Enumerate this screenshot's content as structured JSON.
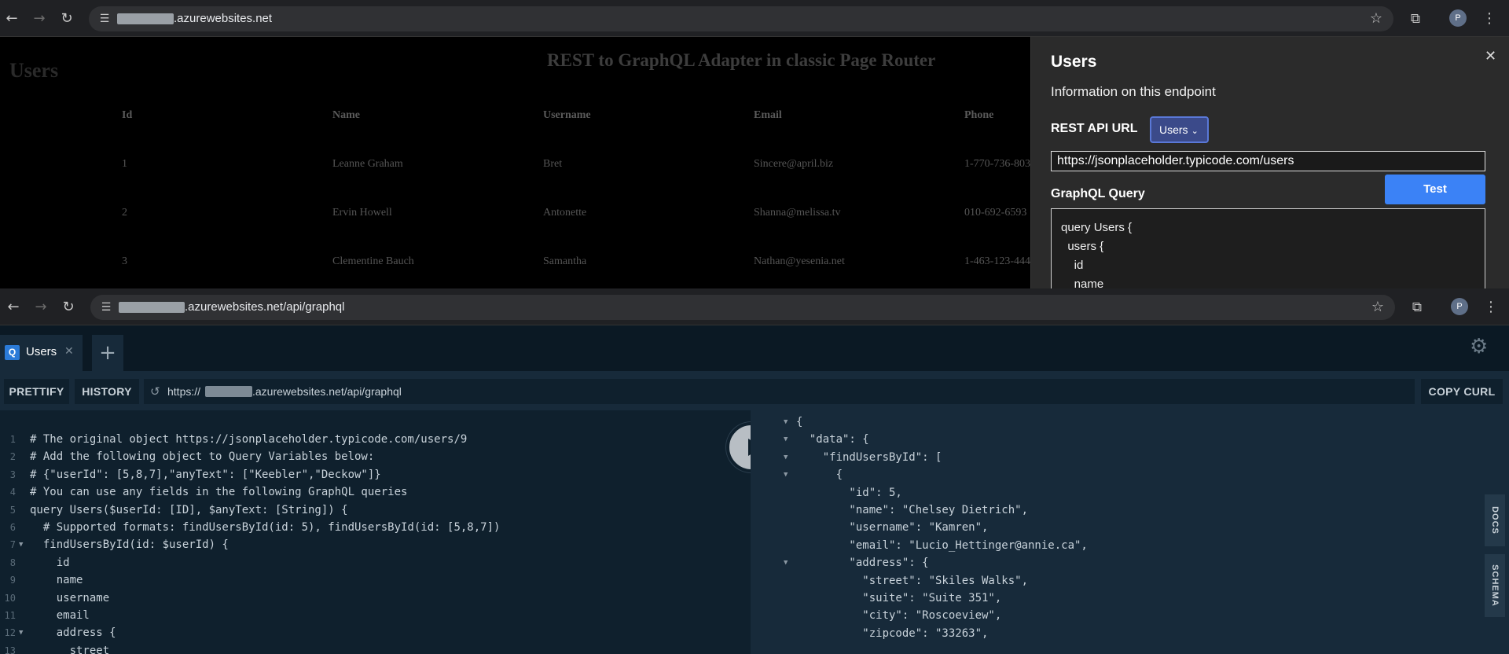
{
  "window1": {
    "url_suffix": ".azurewebsites.net",
    "page_heading": "Users",
    "page_title": "REST to GraphQL Adapter in classic Page Router",
    "table": {
      "headers": [
        "Id",
        "Name",
        "Username",
        "Email",
        "Phone"
      ],
      "rows": [
        [
          "1",
          "Leanne Graham",
          "Bret",
          "Sincere@april.biz",
          "1-770-736-803"
        ],
        [
          "2",
          "Ervin Howell",
          "Antonette",
          "Shanna@melissa.tv",
          "010-692-6593"
        ],
        [
          "3",
          "Clementine Bauch",
          "Samantha",
          "Nathan@yesenia.net",
          "1-463-123-444"
        ]
      ]
    },
    "panel": {
      "title": "Users",
      "info": "Information on this endpoint",
      "rest_label": "REST API URL",
      "select_value": "Users",
      "rest_url": "https://jsonplaceholder.typicode.com/users",
      "test_label": "Test",
      "graphql_label": "GraphQL Query",
      "query": "query Users {\n  users {\n    id\n    name"
    }
  },
  "window2": {
    "url_suffix": ".azurewebsites.net/api/graphql",
    "tab_label": "Users",
    "tab_badge": "Q",
    "prettify": "PRETTIFY",
    "history": "HISTORY",
    "endpoint_prefix": "https://",
    "endpoint_suffix": ".azurewebsites.net/api/graphql",
    "copy_curl": "COPY CURL",
    "docs": "DOCS",
    "schema": "SCHEMA",
    "editor_lines": [
      "# The original object https://jsonplaceholder.typicode.com/users/9",
      "# Add the following object to Query Variables below:",
      "# {\"userId\": [5,8,7],\"anyText\": [\"Keebler\",\"Deckow\"]}",
      "# You can use any fields in the following GraphQL queries",
      "query Users($userId: [ID], $anyText: [String]) {",
      "  # Supported formats: findUsersById(id: 5), findUsersById(id: [5,8,7])",
      "  findUsersById(id: $userId) {",
      "    id",
      "    name",
      "    username",
      "    email",
      "    address {",
      "      street"
    ],
    "response_lines": [
      "{",
      "  \"data\": {",
      "    \"findUsersById\": [",
      "      {",
      "        \"id\": 5,",
      "        \"name\": \"Chelsey Dietrich\",",
      "        \"username\": \"Kamren\",",
      "        \"email\": \"Lucio_Hettinger@annie.ca\",",
      "        \"address\": {",
      "          \"street\": \"Skiles Walks\",",
      "          \"suite\": \"Suite 351\",",
      "          \"city\": \"Roscoeview\",",
      "          \"zipcode\": \"33263\","
    ]
  },
  "colors": {
    "accent": "#3b82f6",
    "graphql_keyword": "#2e9be8",
    "graphql_string": "#4fc1a6",
    "graphql_variable": "#e24b6e"
  },
  "profile_initial": "P"
}
